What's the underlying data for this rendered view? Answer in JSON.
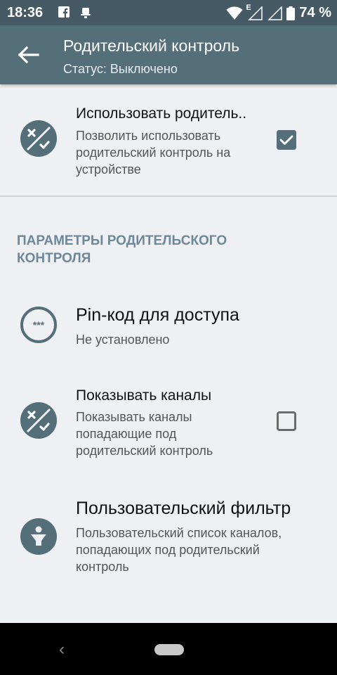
{
  "status_bar": {
    "time": "18:36",
    "network_label": "E",
    "battery_percent": "74 %",
    "icons": [
      "facebook-icon",
      "notification-icon",
      "wifi-icon",
      "signal-icon",
      "signal-icon-2",
      "battery-icon"
    ]
  },
  "app_bar": {
    "title": "Родительский контроль",
    "subtitle": "Статус: Выключено",
    "back_icon": "arrow-left-icon"
  },
  "prefs": {
    "use_parental": {
      "title": "Использовать родитель..",
      "summary": "Позволить использовать родительский контроль на устройстве",
      "checked": true,
      "icon": "parental-icon"
    },
    "category_title": "ПАРАМЕТРЫ РОДИТЕЛЬСКОГО КОНТРОЛЯ",
    "pin": {
      "title": "Pin-код для доступа",
      "summary": "Не установлено",
      "icon": "pin-icon"
    },
    "show_channels": {
      "title": "Показывать каналы",
      "summary": "Показывать каналы попадающие под родительский контроль",
      "checked": false,
      "icon": "parental-icon"
    },
    "user_filter": {
      "title": "Пользовательский фильтр",
      "summary": "Пользовательский список каналов, попадающих под родительский контроль",
      "icon": "filter-icon"
    }
  },
  "colors": {
    "status_bar": "#455a64",
    "app_bar": "#546e7a",
    "accent": "#546e7a",
    "category": "#6d8898",
    "background": "#eef0f3"
  }
}
